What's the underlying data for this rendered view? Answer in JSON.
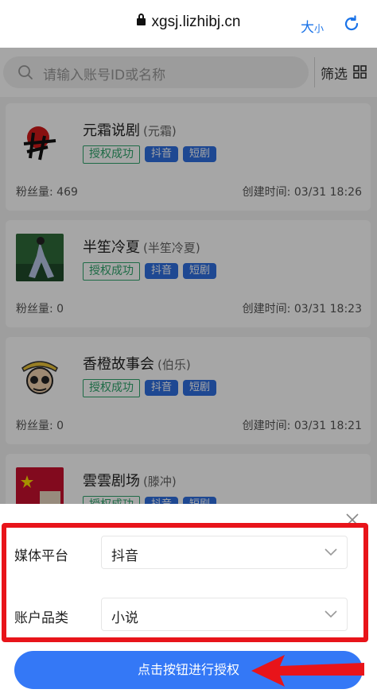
{
  "browser": {
    "url": "xgsj.lizhibj.cn",
    "text_size_big": "大",
    "text_size_small": "小"
  },
  "search": {
    "placeholder": "请输入账号ID或名称",
    "filter_label": "筛选"
  },
  "accounts": [
    {
      "name": "元霜说剧",
      "alias": "(元霜)",
      "status": "授权成功",
      "platform": "抖音",
      "category": "短剧",
      "fans_label": "粉丝量:",
      "fans": "469",
      "created_label": "创建时间:",
      "created": "03/31 18:26"
    },
    {
      "name": "半笙冷夏",
      "alias": "(半笙冷夏)",
      "status": "授权成功",
      "platform": "抖音",
      "category": "短剧",
      "fans_label": "粉丝量:",
      "fans": "0",
      "created_label": "创建时间:",
      "created": "03/31 18:23"
    },
    {
      "name": "香橙故事会",
      "alias": "(伯乐)",
      "status": "授权成功",
      "platform": "抖音",
      "category": "短剧",
      "fans_label": "粉丝量:",
      "fans": "0",
      "created_label": "创建时间:",
      "created": "03/31 18:21"
    },
    {
      "name": "雲雲剧场",
      "alias": "(滕冲)",
      "status": "授权成功",
      "platform": "抖音",
      "category": "短剧"
    }
  ],
  "sheet": {
    "media_label": "媒体平台",
    "media_value": "抖音",
    "category_label": "账户品类",
    "category_value": "小说",
    "submit_label": "点击按钮进行授权"
  },
  "colors": {
    "accent": "#3478f6",
    "success": "#2ea56c",
    "tag_blue": "#2f6fe0",
    "highlight_red": "#e8141a"
  }
}
